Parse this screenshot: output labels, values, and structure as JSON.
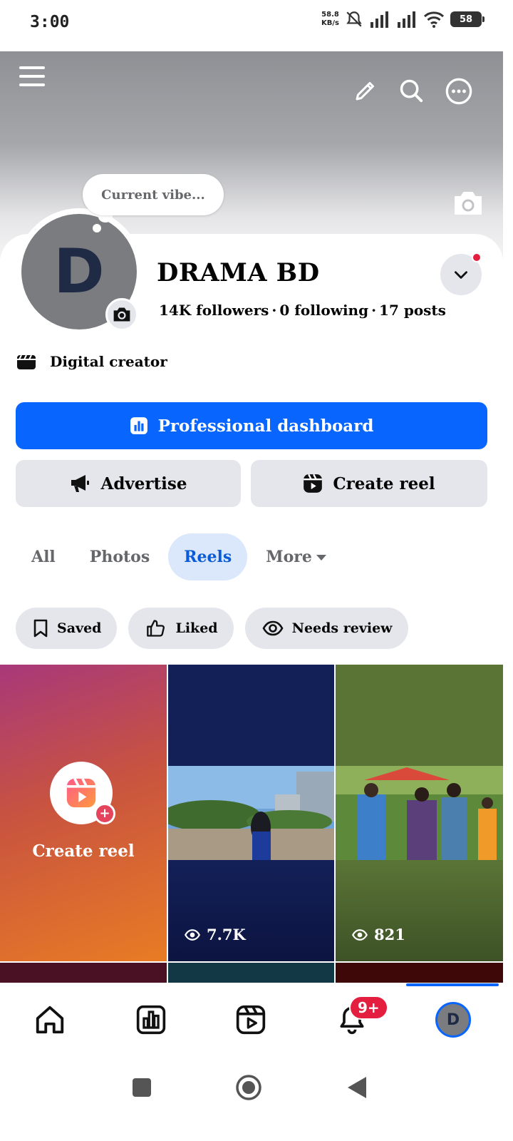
{
  "status_bar": {
    "time": "3:00",
    "net_speed_value": "58.8",
    "net_speed_unit": "KB/s",
    "battery": "58"
  },
  "cover": {
    "vibe_text": "Current vibe..."
  },
  "profile": {
    "avatar_letter": "D",
    "name": "DRAMA BD",
    "followers": "14K followers",
    "following": "0 following",
    "posts": "17 posts",
    "separator": "·",
    "category": "Digital creator"
  },
  "actions": {
    "dashboard_label": "Professional dashboard",
    "advertise_label": "Advertise",
    "create_reel_label": "Create reel"
  },
  "tabs": {
    "all": "All",
    "photos": "Photos",
    "reels": "Reels",
    "more": "More",
    "active": "Reels"
  },
  "filters": {
    "saved": "Saved",
    "liked": "Liked",
    "needs_review": "Needs review"
  },
  "grid": {
    "create_label": "Create reel",
    "reels": [
      {
        "views": "7.7K"
      },
      {
        "views": "821"
      }
    ]
  },
  "bottom_nav": {
    "notification_badge": "9+",
    "avatar_letter": "D"
  },
  "colors": {
    "brand_blue": "#0866ff",
    "notification_red": "#e41e3f",
    "chip_gray": "#e4e6eb"
  },
  "icons": [
    "menu-icon",
    "pencil-icon",
    "search-icon",
    "more-icon",
    "camera-icon",
    "chevron-down-icon",
    "clapperboard-icon",
    "chart-icon",
    "megaphone-icon",
    "reel-icon",
    "bookmark-icon",
    "thumbs-up-icon",
    "eye-icon",
    "home-icon",
    "dashboard-icon",
    "reels-nav-icon",
    "bell-icon"
  ]
}
